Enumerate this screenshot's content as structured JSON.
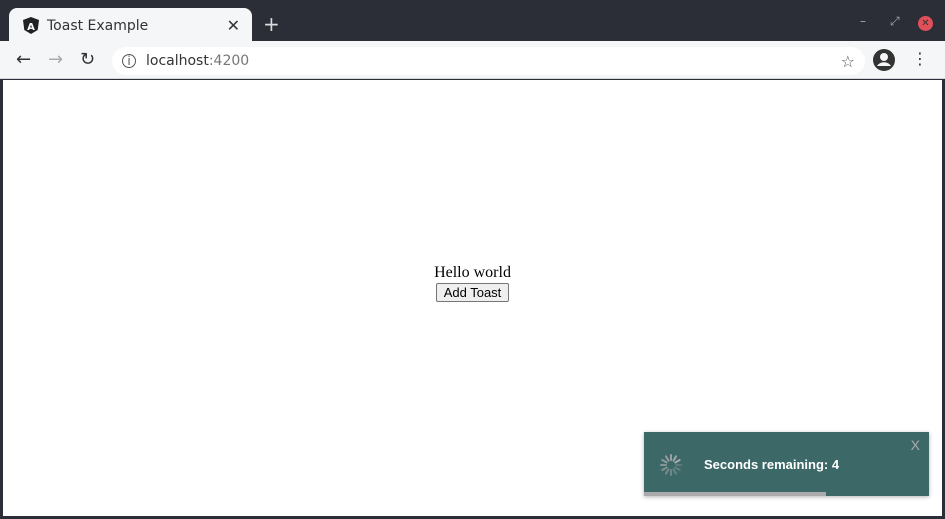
{
  "browser": {
    "tab_title": "Toast Example",
    "url_host": "localhost",
    "url_port": ":4200"
  },
  "page": {
    "heading": "Hello world",
    "add_button": "Add Toast"
  },
  "toast": {
    "message": "Seconds remaining: 4",
    "close_label": "X",
    "progress_percent": 64,
    "background": "#3d6868"
  }
}
